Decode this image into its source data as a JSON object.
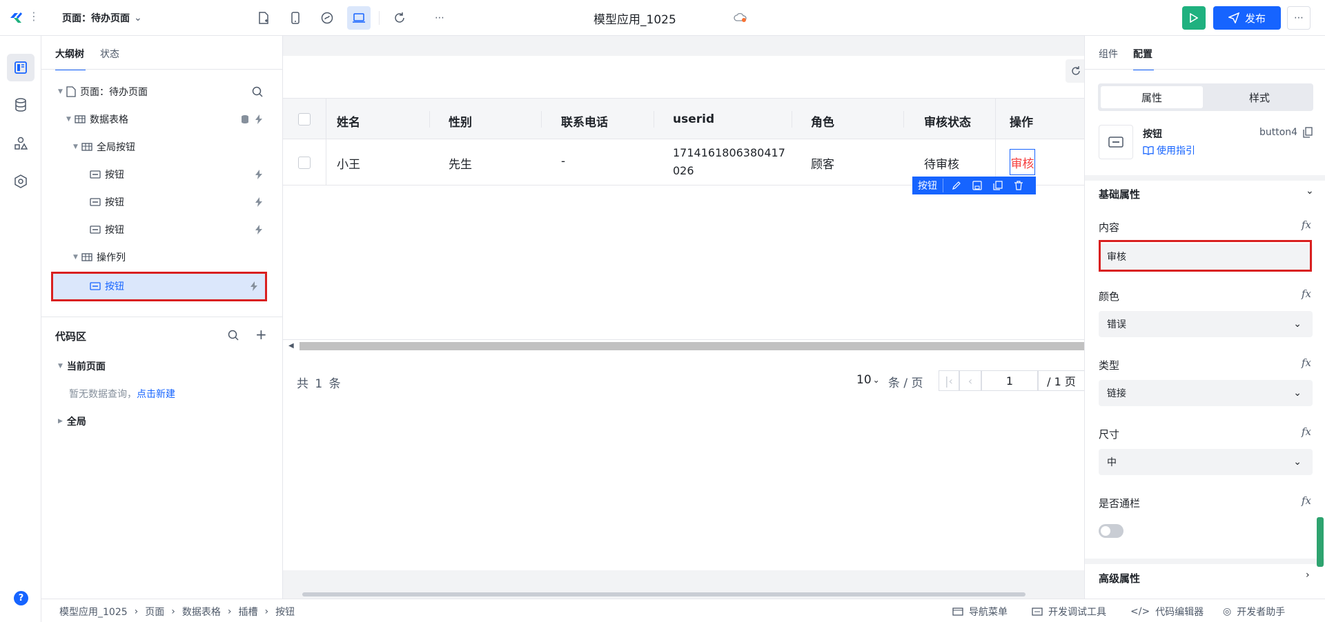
{
  "topbar": {
    "page_selector": "页面：待办页面",
    "app_title": "模型应用_1025",
    "publish_label": "发布"
  },
  "outline": {
    "tabs": [
      "大纲树",
      "状态"
    ],
    "nodes": {
      "page": "页面：待办页面",
      "table": "数据表格",
      "global_buttons": "全局按钮",
      "btn1": "按钮",
      "btn2": "按钮",
      "btn3": "按钮",
      "op_col": "操作列",
      "selected_btn": "按钮"
    }
  },
  "code_zone": {
    "title": "代码区",
    "current_page": "当前页面",
    "empty_text": "暂无数据查询，",
    "create_link": "点击新建",
    "global": "全局"
  },
  "table": {
    "columns": [
      "姓名",
      "性别",
      "联系电话",
      "userid",
      "角色",
      "审核状态",
      "操作"
    ],
    "row": {
      "name": "小王",
      "gender": "先生",
      "phone": "-",
      "userid_line1": "1714161806380417",
      "userid_line2": "026",
      "role": "顾客",
      "status": "待审核",
      "action": "审核"
    },
    "float_toolbar_label": "按钮"
  },
  "pager": {
    "total": "共 1 条",
    "page_size": "10",
    "per_page_unit": "条 / 页",
    "current_page": "1",
    "total_pages": "/ 1 页"
  },
  "right_panel": {
    "tabs": [
      "组件",
      "配置"
    ],
    "segment": [
      "属性",
      "样式"
    ],
    "component": {
      "name": "按钮",
      "id": "button4",
      "guide_link": "使用指引"
    },
    "basic_section": "基础属性",
    "props": {
      "content_label": "内容",
      "content_value": "审核",
      "color_label": "颜色",
      "color_value": "错误",
      "type_label": "类型",
      "type_value": "链接",
      "size_label": "尺寸",
      "size_value": "中",
      "block_label": "是否通栏"
    },
    "fx_symbol": "fx",
    "advanced_section": "高级属性"
  },
  "statusbar": {
    "breadcrumb": [
      "模型应用_1025",
      "页面",
      "数据表格",
      "插槽",
      "按钮"
    ],
    "tools": [
      "导航菜单",
      "开发调试工具",
      "代码编辑器",
      "开发者助手"
    ]
  },
  "colors": {
    "accent": "#1664ff",
    "run_green": "#1fb17f",
    "error_red": "#f53f3f",
    "highlight_red": "#d92020"
  }
}
